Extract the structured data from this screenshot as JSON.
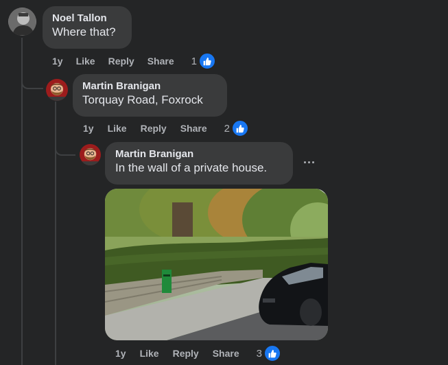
{
  "comments": [
    {
      "author": "Noel Tallon",
      "text": "Where that?",
      "time": "1y",
      "like": "Like",
      "reply": "Reply",
      "share": "Share",
      "reaction_count": "1",
      "avatar_icon": "grayscale-portrait"
    },
    {
      "author": "Martin Branigan",
      "text": "Torquay Road, Foxrock",
      "time": "1y",
      "like": "Like",
      "reply": "Reply",
      "share": "Share",
      "reaction_count": "2",
      "avatar_icon": "cartoon-bearded-man"
    },
    {
      "author": "Martin Branigan",
      "text": "In the wall of a private house.",
      "time": "1y",
      "like": "Like",
      "reply": "Reply",
      "share": "Share",
      "reaction_count": "3",
      "avatar_icon": "cartoon-bearded-man",
      "more_label": "...",
      "attachment": "street-photo-green-postbox"
    }
  ],
  "colors": {
    "background": "#242526",
    "bubble": "#3a3b3c",
    "text": "#e4e6eb",
    "muted": "#b0b3b8",
    "like_blue": "#1877f2"
  }
}
